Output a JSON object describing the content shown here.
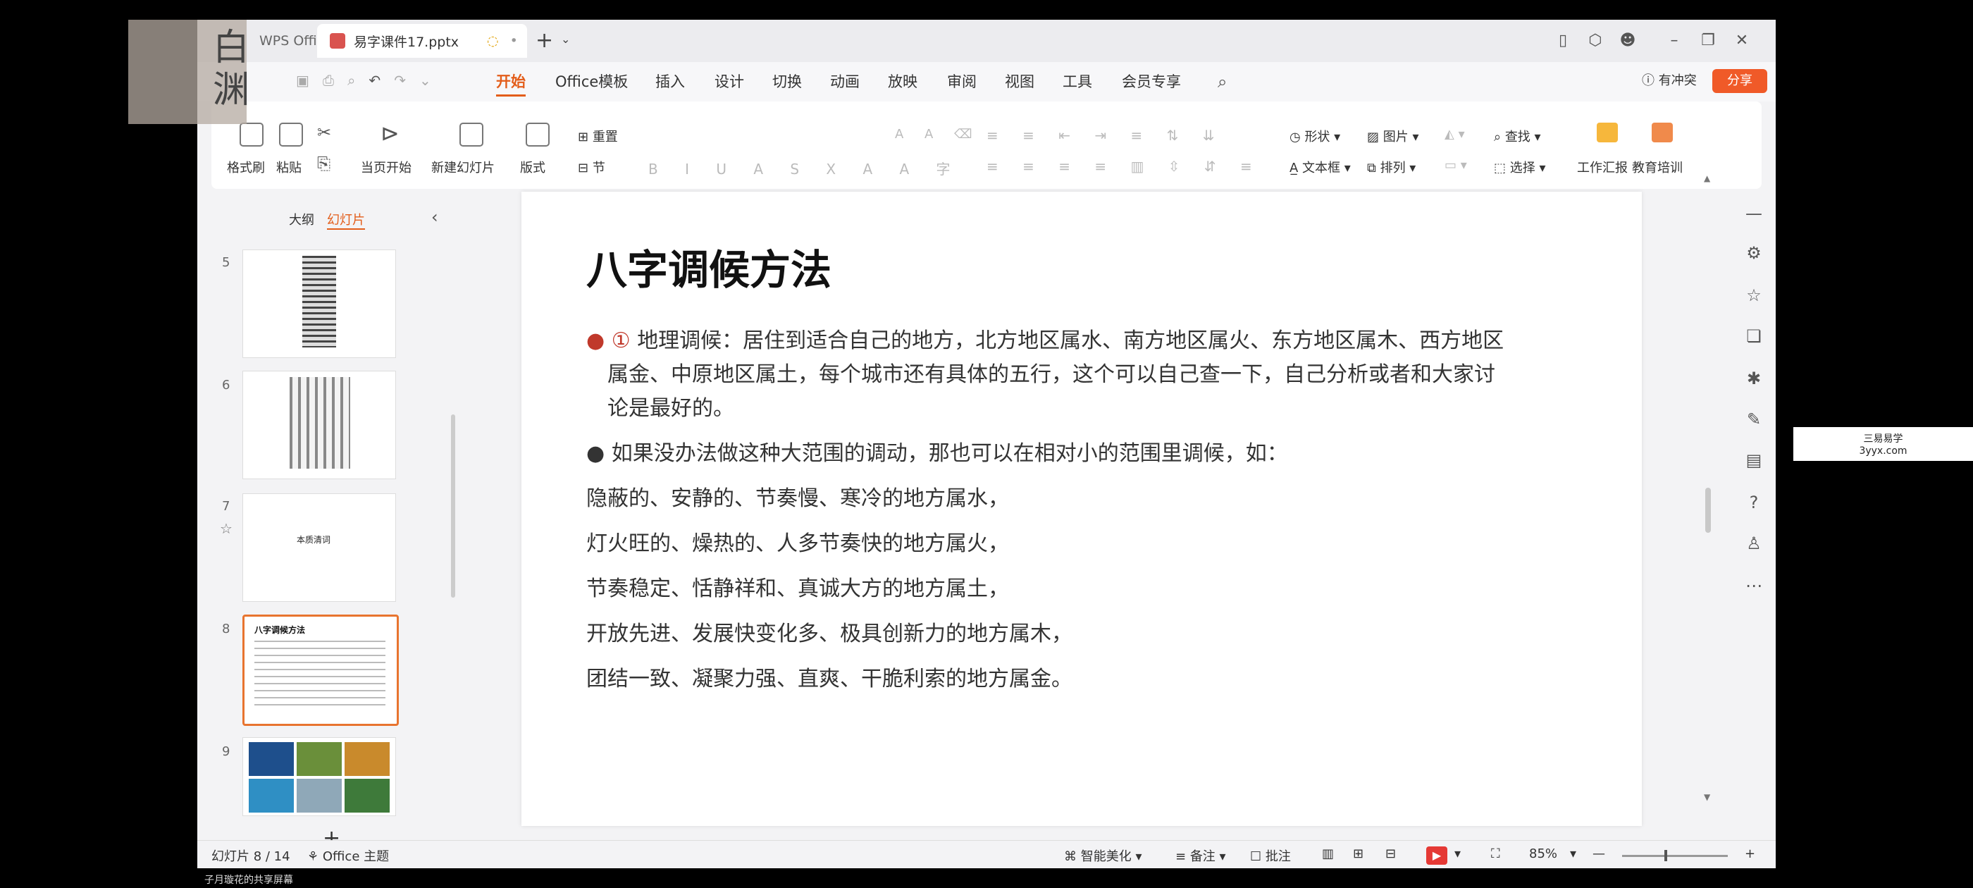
{
  "window": {
    "app_tab": "WPS Office",
    "file_tab": "易字课件17.pptx"
  },
  "menu": {
    "items": [
      "开始",
      "Office模板",
      "插入",
      "设计",
      "切换",
      "动画",
      "放映",
      "审阅",
      "视图",
      "工具",
      "会员专享"
    ],
    "conflict": "有冲突",
    "share": "分享"
  },
  "ribbon": {
    "format_brush": "格式刷",
    "paste": "粘贴",
    "play_from_current": "当页开始",
    "new_slide": "新建幻灯片",
    "layout": "版式",
    "section": "节",
    "reset": "重置",
    "shape": "形状",
    "picture": "图片",
    "find": "查找",
    "textbox": "文本框",
    "arrange": "排列",
    "select": "选择",
    "work_report": "工作汇报",
    "edu_training": "教育培训"
  },
  "left_panel": {
    "tab_outline": "大纲",
    "tab_slides": "幻灯片",
    "slide_numbers": [
      "5",
      "6",
      "7",
      "8",
      "9"
    ],
    "thumb7_title": "本质清词",
    "thumb8_title": "八字调候方法"
  },
  "slide": {
    "title": "八字调候方法",
    "bullet1_marker": "①",
    "bullet1_line1": "地理调候：居住到适合自己的地方，北方地区属水、南方地区属火、东方地区属木、西方地区",
    "bullet1_line2": "属金、中原地区属土，每个城市还有具体的五行，这个可以自己查一下，自己分析或者和大家讨",
    "bullet1_line3": "论是最好的。",
    "bullet2": "如果没办法做这种大范围的调动，那也可以在相对小的范围里调候，如：",
    "lines": [
      "隐蔽的、安静的、节奏慢、寒冷的地方属水，",
      "灯火旺的、燥热的、人多节奏快的地方属火，",
      "节奏稳定、恬静祥和、真诚大方的地方属土，",
      "开放先进、发展快变化多、极具创新力的地方属木，",
      "团结一致、凝聚力强、直爽、干脆利索的地方属金。"
    ]
  },
  "status": {
    "slide_counter": "幻灯片 8 / 14",
    "theme": "Office 主题",
    "beautify": "智能美化",
    "notes": "备注",
    "comments": "批注",
    "zoom": "85%"
  },
  "watermark": {
    "line1": "三易易学",
    "line2": "3yyx.com"
  },
  "overlay": {
    "logo_text": "白渊",
    "caption": "子月璇花的共享屏幕"
  }
}
